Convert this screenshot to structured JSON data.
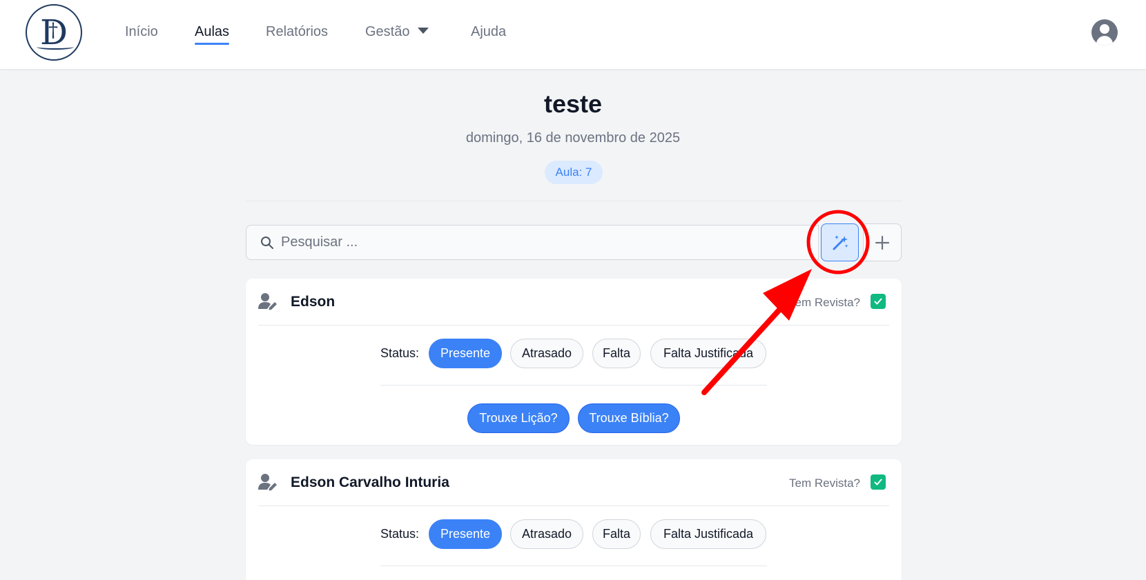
{
  "header": {
    "logo_alt": "D",
    "nav": [
      {
        "label": "Início"
      },
      {
        "label": "Aulas"
      },
      {
        "label": "Relatórios"
      },
      {
        "label": "Gestão"
      },
      {
        "label": "Ajuda"
      }
    ],
    "active_nav": "Aulas"
  },
  "page": {
    "title": "teste",
    "date": "domingo, 16 de novembro de 2025",
    "aula_badge": "Aula: 7"
  },
  "search": {
    "placeholder": "Pesquisar ...",
    "value": ""
  },
  "toolbar": {
    "magic_icon": "magic-wand-icon",
    "add_icon": "plus-icon"
  },
  "students": [
    {
      "name": "Edson",
      "revista_label": "Tem Revista?",
      "revista_checked": true,
      "status_label": "Status:",
      "status_options": [
        "Presente",
        "Atrasado",
        "Falta",
        "Falta Justificada"
      ],
      "status_selected": "Presente",
      "toggles": [
        "Trouxe Lição?",
        "Trouxe Bíblia?"
      ]
    },
    {
      "name": "Edson Carvalho Inturia",
      "revista_label": "Tem Revista?",
      "revista_checked": true,
      "status_label": "Status:",
      "status_options": [
        "Presente",
        "Atrasado",
        "Falta",
        "Falta Justificada"
      ],
      "status_selected": "Presente"
    }
  ],
  "colors": {
    "accent": "#3b82f6",
    "accent_light": "#dbeafe",
    "success": "#10b981",
    "annotation": "#ff0000"
  }
}
